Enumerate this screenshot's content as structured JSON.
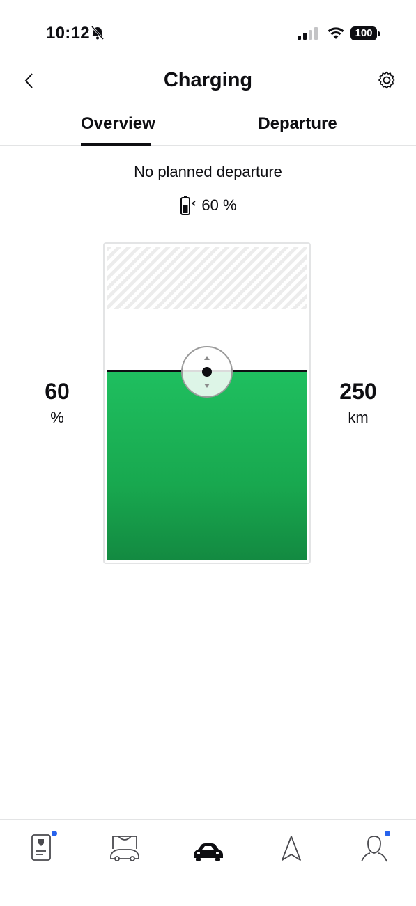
{
  "status_bar": {
    "time": "10:12",
    "battery": "100"
  },
  "header": {
    "title": "Charging"
  },
  "tabs": [
    {
      "label": "Overview",
      "selected": true
    },
    {
      "label": "Departure",
      "selected": false
    }
  ],
  "charging": {
    "departure_text": "No planned departure",
    "current_soc": "60 %",
    "target_percent_value": "60",
    "target_percent_unit": "%",
    "range_value": "250",
    "range_unit": "km",
    "level_fraction": 0.6,
    "max_fraction": 0.8
  },
  "nav": [
    {
      "name": "phone-card-icon",
      "badge": true
    },
    {
      "name": "car-shop-icon",
      "badge": false
    },
    {
      "name": "car-icon",
      "active": true
    },
    {
      "name": "navigation-icon",
      "badge": false
    },
    {
      "name": "profile-icon",
      "badge": true
    }
  ],
  "colors": {
    "accent": "#1fbf5f",
    "badge": "#2762ec",
    "text": "#0e0e12"
  }
}
